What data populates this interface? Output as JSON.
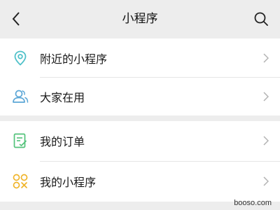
{
  "header": {
    "title": "小程序",
    "back_icon": "chevron-left-icon",
    "search_icon": "search-icon"
  },
  "groups": [
    {
      "items": [
        {
          "label": "附近的小程序",
          "icon": "location-pin-icon",
          "icon_color": "#4fc1c9"
        },
        {
          "label": "大家在用",
          "icon": "users-icon",
          "icon_color": "#5ba6d6"
        }
      ]
    },
    {
      "items": [
        {
          "label": "我的订单",
          "icon": "order-list-icon",
          "icon_color": "#52c27a"
        },
        {
          "label": "我的小程序",
          "icon": "mini-program-grid-icon",
          "icon_color": "#f0b429"
        }
      ]
    }
  ],
  "watermark": "booso.com",
  "colors": {
    "background": "#ededed",
    "card": "#ffffff",
    "chevron": "#b2b2b2"
  }
}
